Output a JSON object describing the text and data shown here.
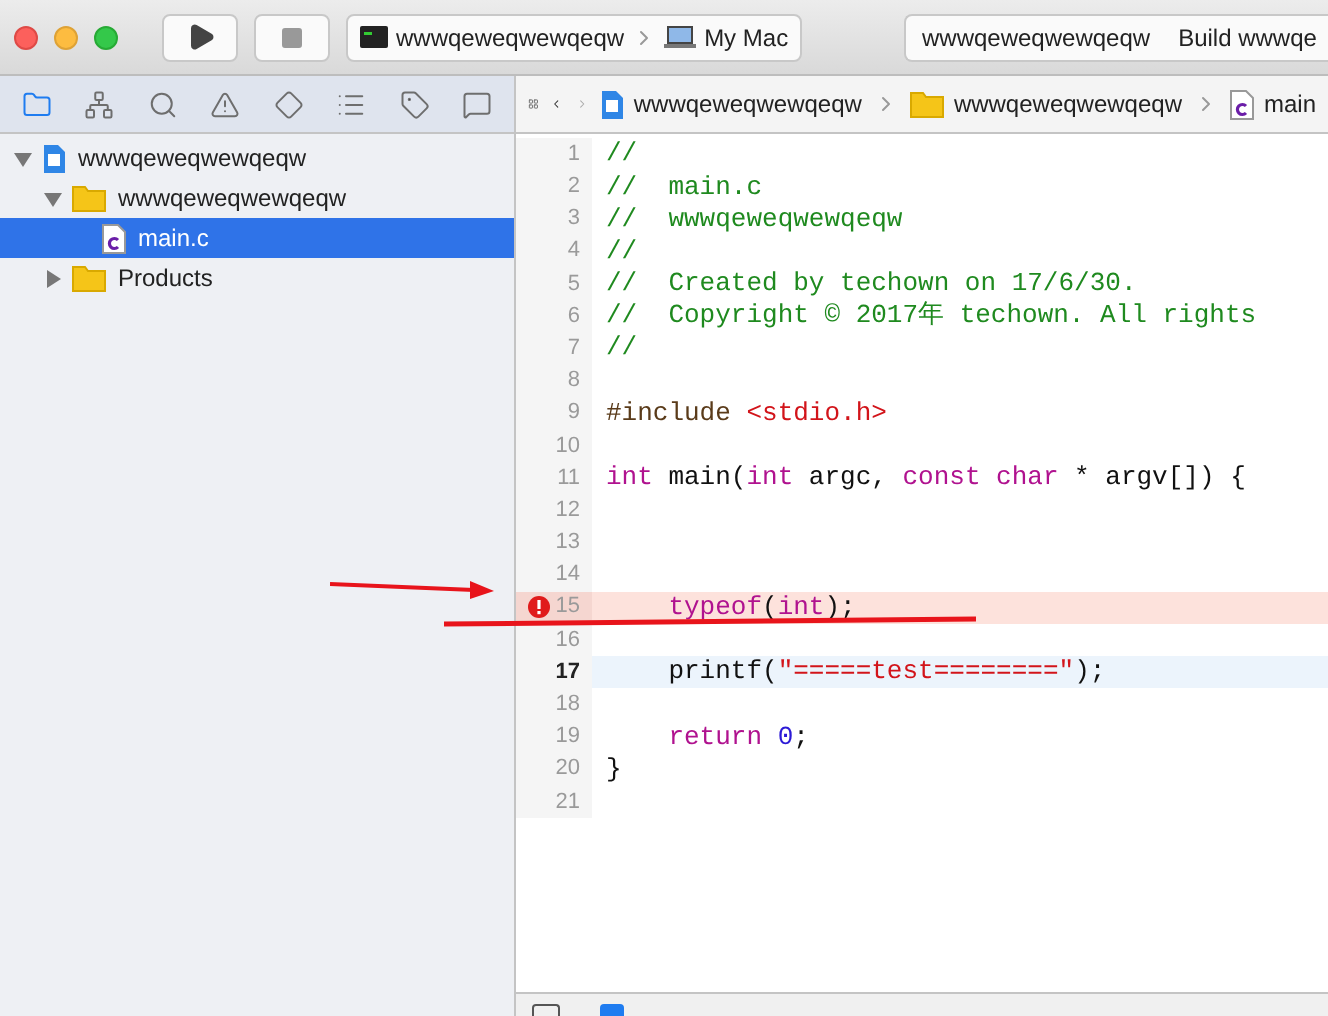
{
  "toolbar": {
    "scheme": "wwwqeweqwewqeqw",
    "destination": "My Mac",
    "activity": "wwwqeweqwewqeqw",
    "activity_status": "Build wwwqe"
  },
  "navigator_tabs": [
    {
      "selected": true
    },
    {
      "selected": false
    },
    {
      "selected": false
    },
    {
      "selected": false
    },
    {
      "selected": false
    },
    {
      "selected": false
    },
    {
      "selected": false
    },
    {
      "selected": false
    }
  ],
  "tree": [
    {
      "label": "wwwqeweqwewqeqw",
      "kind": "project",
      "expanded": true,
      "selected": false,
      "children": [
        {
          "label": "wwwqeweqwewqeqw",
          "kind": "folder",
          "expanded": true,
          "selected": false,
          "children": [
            {
              "label": "main.c",
              "kind": "file",
              "selected": true
            }
          ]
        },
        {
          "label": "Products",
          "kind": "folder",
          "expanded": false,
          "selected": false
        }
      ]
    }
  ],
  "jump_bar": [
    {
      "label": "wwwqeweqwewqeqw",
      "kind": "project"
    },
    {
      "label": "wwwqeweqwewqeqw",
      "kind": "folder"
    },
    {
      "label": "main",
      "kind": "file"
    }
  ],
  "code_lines": [
    {
      "number": "1",
      "error": false,
      "current": false,
      "tokens": [
        {
          "t": "//",
          "color": "#1f8a1f"
        }
      ]
    },
    {
      "number": "2",
      "error": false,
      "current": false,
      "tokens": [
        {
          "t": "//  main.c",
          "color": "#1f8a1f"
        }
      ]
    },
    {
      "number": "3",
      "error": false,
      "current": false,
      "tokens": [
        {
          "t": "//  wwwqeweqwewqeqw",
          "color": "#1f8a1f"
        }
      ]
    },
    {
      "number": "4",
      "error": false,
      "current": false,
      "tokens": [
        {
          "t": "//",
          "color": "#1f8a1f"
        }
      ]
    },
    {
      "number": "5",
      "error": false,
      "current": false,
      "tokens": [
        {
          "t": "//  Created by techown on 17/6/30.",
          "color": "#1f8a1f"
        }
      ]
    },
    {
      "number": "6",
      "error": false,
      "current": false,
      "tokens": [
        {
          "t": "//  Copyright © 2017年 techown. All rights",
          "color": "#1f8a1f"
        }
      ]
    },
    {
      "number": "7",
      "error": false,
      "current": false,
      "tokens": [
        {
          "t": "//",
          "color": "#1f8a1f"
        }
      ]
    },
    {
      "number": "8",
      "error": false,
      "current": false
    },
    {
      "number": "9",
      "error": false,
      "current": false,
      "tokens": [
        {
          "t": "#include ",
          "color": "#5a3b1a"
        },
        {
          "t": "<stdio.h>",
          "color": "#d2141a"
        }
      ]
    },
    {
      "number": "10",
      "error": false,
      "current": false
    },
    {
      "number": "11",
      "error": false,
      "current": false,
      "tokens": [
        {
          "t": "int",
          "color": "#b0128f"
        },
        {
          "t": " main(",
          "color": "#111111"
        },
        {
          "t": "int",
          "color": "#b0128f"
        },
        {
          "t": " argc, ",
          "color": "#111111"
        },
        {
          "t": "const char",
          "color": "#b0128f"
        },
        {
          "t": " * argv[]) {",
          "color": "#111111"
        }
      ]
    },
    {
      "number": "12",
      "error": false,
      "current": false
    },
    {
      "number": "13",
      "error": false,
      "current": false
    },
    {
      "number": "14",
      "error": false,
      "current": false
    },
    {
      "number": "15",
      "error": true,
      "current": false,
      "tokens": [
        {
          "t": "    typeof",
          "color": "#b0128f"
        },
        {
          "t": "(",
          "color": "#111111"
        },
        {
          "t": "int",
          "color": "#b0128f"
        },
        {
          "t": ");",
          "color": "#111111"
        }
      ]
    },
    {
      "number": "16",
      "error": false,
      "current": false
    },
    {
      "number": "17",
      "error": false,
      "current": true,
      "tokens": [
        {
          "t": "    printf(",
          "color": "#111111"
        },
        {
          "t": "\"=====test========\"",
          "color": "#d2141a"
        },
        {
          "t": ");",
          "color": "#111111"
        }
      ]
    },
    {
      "number": "18",
      "error": false,
      "current": false
    },
    {
      "number": "19",
      "error": false,
      "current": false,
      "tokens": [
        {
          "t": "    return ",
          "color": "#b0128f"
        },
        {
          "t": "0",
          "color": "#2c1ad6"
        },
        {
          "t": ";",
          "color": "#111111"
        }
      ]
    },
    {
      "number": "20",
      "error": false,
      "current": false,
      "tokens": [
        {
          "t": "}",
          "color": "#111111"
        }
      ]
    },
    {
      "number": "21",
      "error": false,
      "current": false
    }
  ]
}
